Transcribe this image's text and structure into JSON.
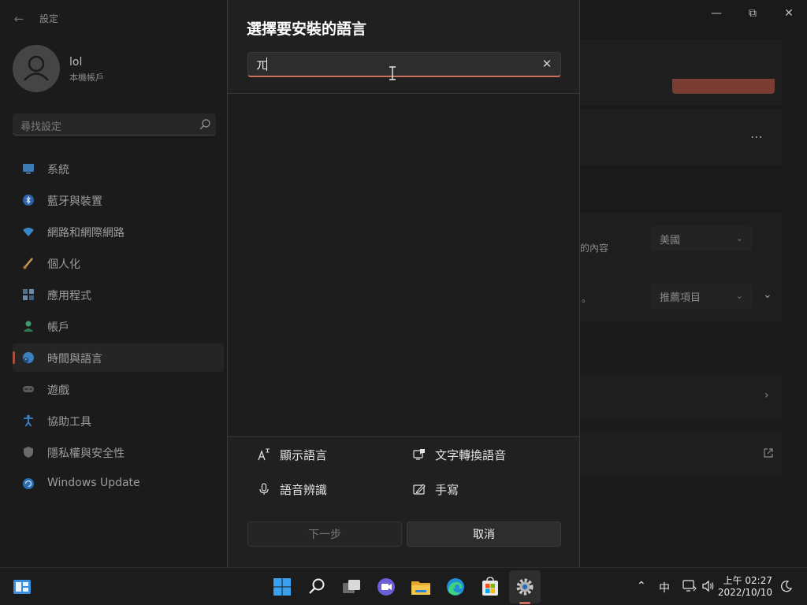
{
  "app": {
    "title": "設定"
  },
  "user": {
    "name": "lol",
    "account_type": "本機帳戶"
  },
  "search": {
    "placeholder": "尋找設定"
  },
  "sidebar": {
    "items": [
      {
        "label": "系統",
        "icon": "monitor-icon"
      },
      {
        "label": "藍牙與裝置",
        "icon": "bluetooth-icon"
      },
      {
        "label": "網路和網際網路",
        "icon": "wifi-icon"
      },
      {
        "label": "個人化",
        "icon": "brush-icon"
      },
      {
        "label": "應用程式",
        "icon": "apps-icon"
      },
      {
        "label": "帳戶",
        "icon": "person-icon"
      },
      {
        "label": "時間與語言",
        "icon": "globe-clock-icon",
        "active": true
      },
      {
        "label": "遊戲",
        "icon": "gamepad-icon"
      },
      {
        "label": "協助工具",
        "icon": "accessibility-icon"
      },
      {
        "label": "隱私權與安全性",
        "icon": "shield-icon"
      },
      {
        "label": "Windows Update",
        "icon": "update-icon"
      }
    ]
  },
  "background": {
    "country_suffix": "的內容",
    "country_value": "美國",
    "format_value": "推薦項目",
    "period": "。"
  },
  "dialog": {
    "title": "選擇要安裝的語言",
    "search_value": "ㄫ",
    "features": [
      {
        "label": "顯示語言",
        "icon": "display-language-icon"
      },
      {
        "label": "文字轉換語音",
        "icon": "text-to-speech-icon"
      },
      {
        "label": "語音辨識",
        "icon": "microphone-icon"
      },
      {
        "label": "手寫",
        "icon": "handwriting-icon"
      }
    ],
    "next_label": "下一步",
    "cancel_label": "取消"
  },
  "taskbar": {
    "ime": "中",
    "time": "上午 02:27",
    "date": "2022/10/10"
  },
  "colors": {
    "accent": "#c9705e",
    "active_bar": "#a54f3e"
  }
}
